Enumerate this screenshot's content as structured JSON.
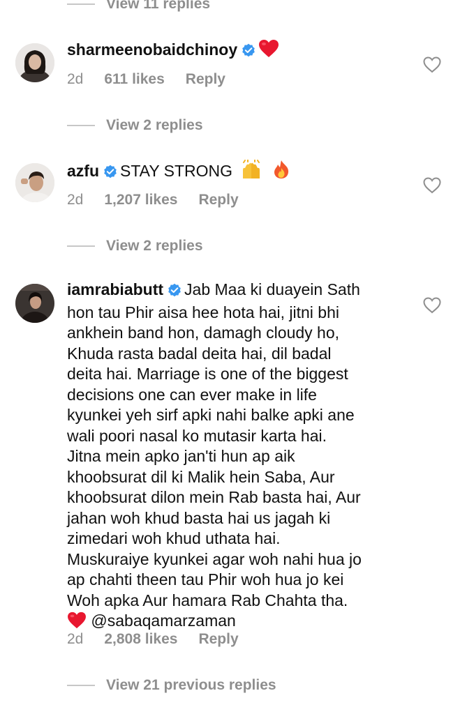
{
  "top_view_replies": "View 11 replies",
  "comments": [
    {
      "username": "sharmeenobaidchinoy",
      "text": "",
      "time": "2d",
      "likes": "611 likes",
      "reply": "Reply",
      "view_replies": "View 2 replies"
    },
    {
      "username": "azfu",
      "text": "STAY STRONG",
      "time": "2d",
      "likes": "1,207 likes",
      "reply": "Reply",
      "view_replies": "View 2 replies"
    },
    {
      "username": "iamrabiabutt",
      "text_first": "Jab Maa ki duayein Sath",
      "lines": [
        "hon tau Phir aisa hee hota hai, jitni bhi",
        "ankhein band hon, damagh cloudy ho,",
        "Khuda rasta badal deita hai, dil badal",
        "deita hai. Marriage is one of the biggest",
        "decisions one can ever make in life",
        "kyunkei yeh sirf apki nahi balke apki ane",
        "wali poori nasal ko mutasir karta hai.",
        "Jitna mein apko jan'ti hun ap aik",
        "khoobsurat dil ki Malik hein Saba, Aur",
        "khoobsurat dilon mein Rab basta hai, Aur",
        "jahan woh khud basta hai us jagah ki",
        "zimedari woh khud uthata hai.",
        "Muskuraiye kyunkei agar woh nahi hua jo",
        "ap chahti theen tau Phir woh hua jo kei",
        "Woh apka Aur hamara Rab Chahta tha."
      ],
      "mention": "@sabaqamarzaman",
      "time": "2d",
      "likes": "2,808 likes",
      "reply": "Reply",
      "view_replies": "View 21 previous replies"
    }
  ],
  "icons": {
    "verified": "verified-badge-icon",
    "heart": "heart-outline-icon",
    "red_heart": "red-heart-emoji",
    "raised_hands": "raising-hands-emoji",
    "fire": "fire-emoji"
  },
  "colors": {
    "verified_blue": "#3897f0",
    "secondary_text": "#8e8e8e",
    "emoji_red": "#e8172f"
  }
}
